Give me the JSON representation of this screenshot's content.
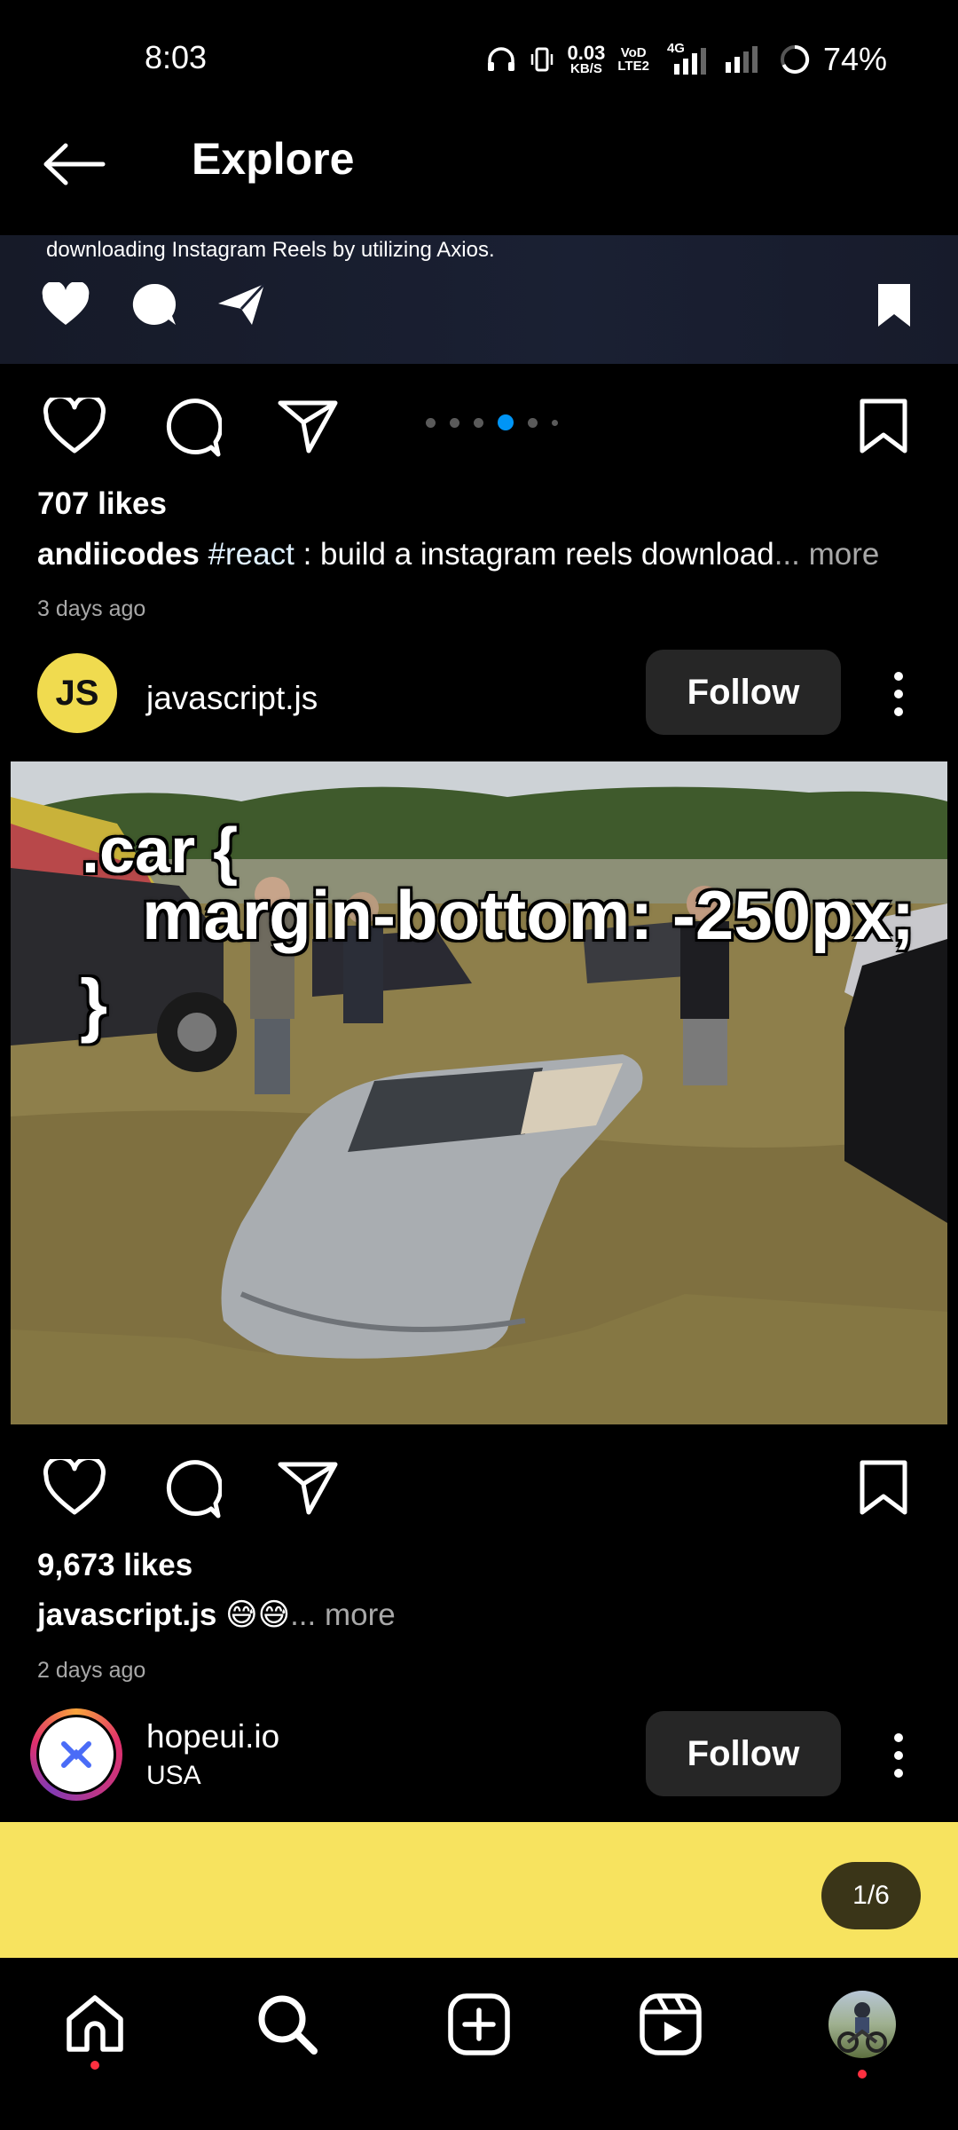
{
  "status_bar": {
    "time": "8:03",
    "net_speed": "0.03",
    "net_unit": "KB/S",
    "volte_top": "VoD",
    "volte_bottom": "LTE2",
    "network": "4G",
    "battery": "74%"
  },
  "header": {
    "title": "Explore"
  },
  "previous_post": {
    "caption_fragment": "downloading Instagram Reels by utilizing Axios.",
    "likes": "707 likes",
    "caption_user": "andiicodes",
    "caption_hashtag": "#react",
    "caption_text": " : build a instagram reels download",
    "caption_more": "... more",
    "timestamp": "3 days ago",
    "carousel_dots": 6,
    "carousel_active": 3
  },
  "post": {
    "avatar_initials": "JS",
    "username": "javascript.js",
    "follow_label": "Follow",
    "meme": {
      "line1": ".car {",
      "line2": "margin-bottom: -250px;",
      "line3": "}"
    },
    "likes": "9,673 likes",
    "caption_user": "javascript.js",
    "caption_emoji": "😅😅",
    "caption_more": "... more",
    "timestamp": "2 days ago"
  },
  "next_post": {
    "username": "hopeui.io",
    "location": "USA",
    "follow_label": "Follow",
    "page_indicator": "1/6",
    "background_color": "#f7e35f"
  },
  "bottom_nav": {
    "items": [
      "home-icon",
      "search-icon",
      "create-icon",
      "reels-icon",
      "profile-avatar"
    ],
    "notification_color": "#ff3040"
  }
}
